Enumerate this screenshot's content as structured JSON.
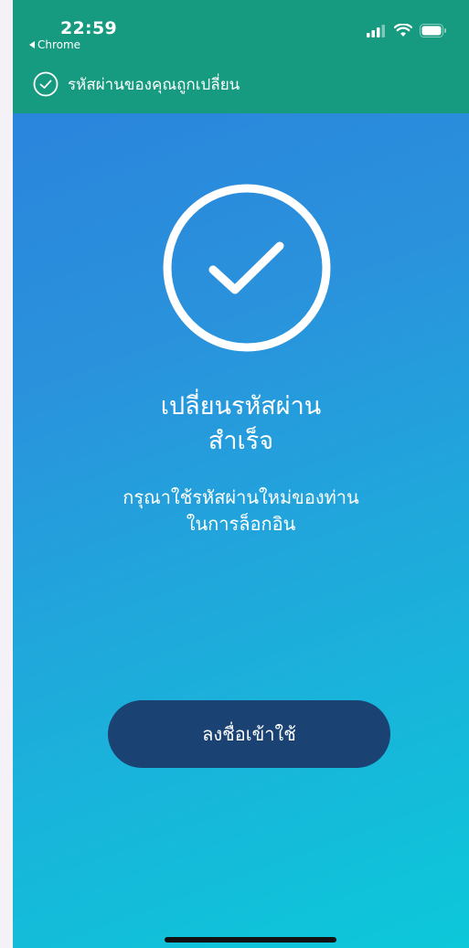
{
  "status_bar": {
    "time": "22:59",
    "back_app": "Chrome",
    "icons": [
      "signal-icon",
      "wifi-icon",
      "battery-icon"
    ]
  },
  "banner": {
    "icon": "check-circle-icon",
    "text": "รหัสผ่านของคุณถูกเปลี่ยน"
  },
  "main": {
    "icon": "large-check-circle-icon",
    "title_line1": "เปลี่ยนรหัสผ่าน",
    "title_line2": "สำเร็จ",
    "message_line1": "กรุณาใช้รหัสผ่านใหม่ของท่าน",
    "message_line2": "ในการล็อกอิน",
    "login_button": "ลงชื่อเข้าใช้"
  },
  "colors": {
    "header_bg": "#179b80",
    "button_bg": "#1a4272",
    "gradient_start": "#2a7fdc",
    "gradient_end": "#0cc8d9"
  }
}
